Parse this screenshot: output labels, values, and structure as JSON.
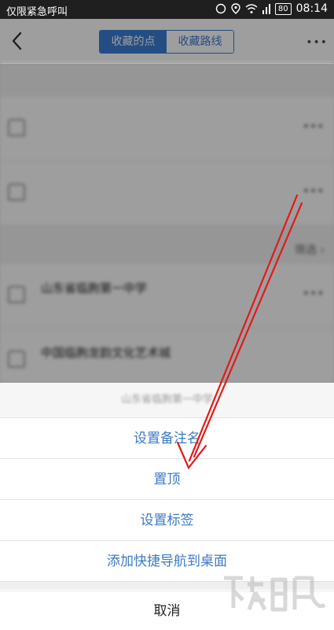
{
  "status_bar": {
    "carrier": "仅限紧急呼叫",
    "battery": "80",
    "time": "08:14"
  },
  "header": {
    "tabs": [
      {
        "label": "收藏的点",
        "active": true
      },
      {
        "label": "收藏路线",
        "active": false
      }
    ],
    "more": "•••"
  },
  "background_list": {
    "filter_label": "筛选",
    "rows_more": "•••",
    "row_titles": [
      "山东省临朐第一中学",
      "中国临朐龙韵文化艺术城"
    ]
  },
  "action_sheet": {
    "title": "山东省临朐第一中学",
    "options": [
      "设置备注名",
      "置顶",
      "设置标签",
      "添加快捷导航到桌面"
    ],
    "cancel": "取消"
  },
  "colors": {
    "accent": "#3a7cd3",
    "annotation_arrow": "#e01b1b"
  }
}
